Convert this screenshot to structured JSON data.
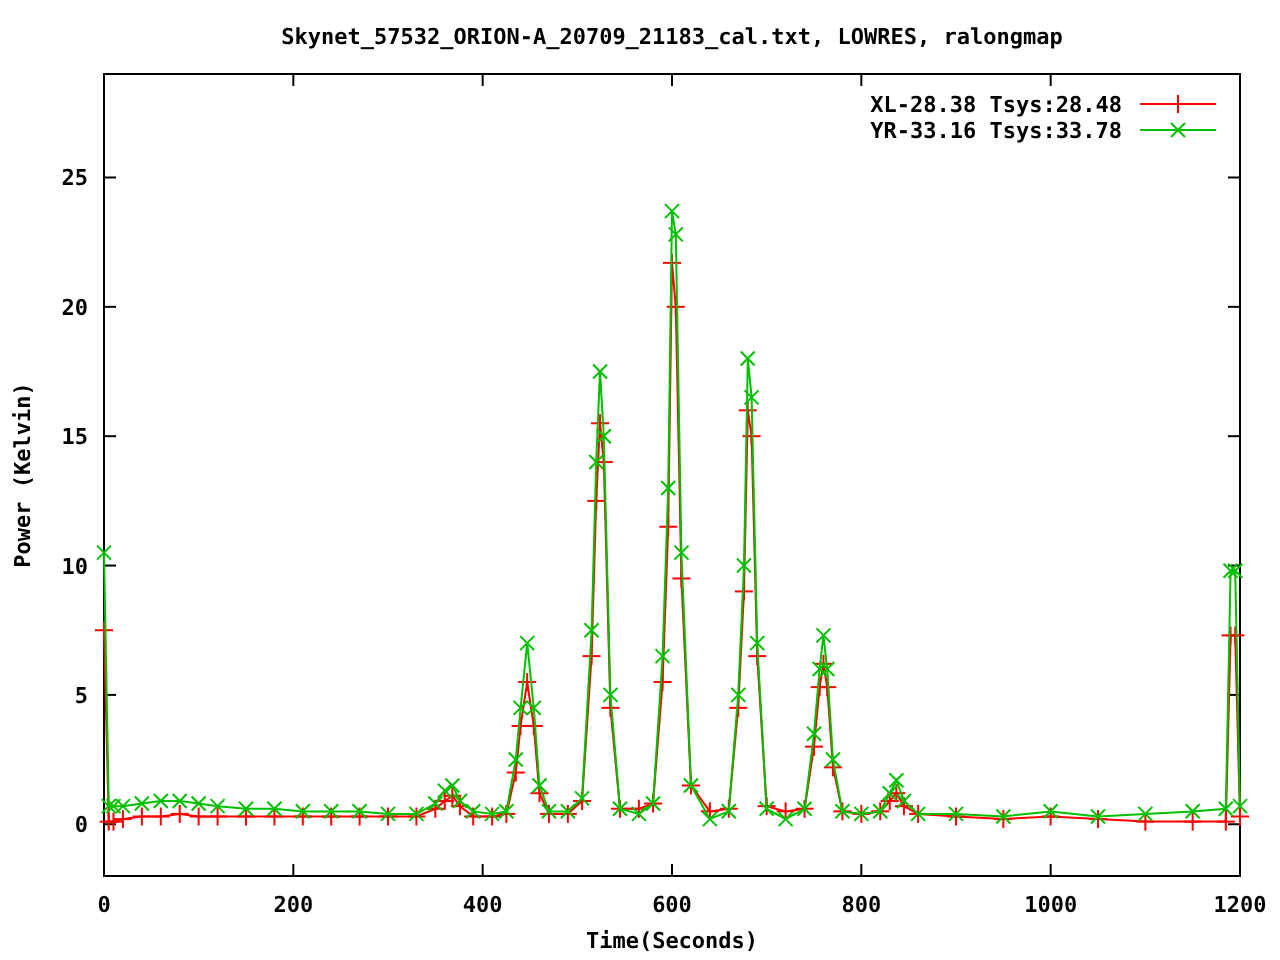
{
  "chart_data": {
    "type": "line",
    "title": "Skynet_57532_ORION-A_20709_21183_cal.txt, LOWRES, ralongmap",
    "xlabel": "Time(Seconds)",
    "ylabel": "Power (Kelvin)",
    "x": [
      0,
      5,
      10,
      20,
      40,
      60,
      80,
      100,
      120,
      150,
      180,
      210,
      240,
      270,
      300,
      330,
      350,
      360,
      368,
      376,
      390,
      410,
      425,
      435,
      440,
      447,
      454,
      460,
      470,
      490,
      505,
      515,
      520,
      524,
      528,
      535,
      545,
      565,
      580,
      590,
      596,
      600,
      604,
      610,
      620,
      640,
      660,
      670,
      676,
      680,
      684,
      690,
      700,
      720,
      740,
      750,
      756,
      760,
      764,
      770,
      780,
      800,
      820,
      830,
      837,
      845,
      860,
      900,
      950,
      1000,
      1050,
      1100,
      1150,
      1185,
      1190,
      1195,
      1200
    ],
    "series": [
      {
        "name": "XL-28.38 Tsys:28.48",
        "color": "#ff0000",
        "marker": "plus",
        "values": [
          7.5,
          0.1,
          0.1,
          0.2,
          0.3,
          0.3,
          0.4,
          0.3,
          0.3,
          0.3,
          0.3,
          0.3,
          0.3,
          0.3,
          0.3,
          0.3,
          0.6,
          0.9,
          1.1,
          0.7,
          0.3,
          0.3,
          0.4,
          2,
          3.8,
          5.5,
          3.8,
          1.2,
          0.4,
          0.4,
          0.9,
          6.5,
          12.5,
          15.5,
          14,
          4.5,
          0.6,
          0.6,
          0.8,
          5.5,
          11.5,
          21.7,
          20,
          9.5,
          1.5,
          0.5,
          0.6,
          4.5,
          9,
          16,
          15,
          6.5,
          0.7,
          0.5,
          0.6,
          3,
          5.3,
          6.2,
          5.3,
          2.2,
          0.5,
          0.4,
          0.5,
          0.9,
          1.2,
          0.7,
          0.4,
          0.3,
          0.2,
          0.3,
          0.2,
          0.1,
          0.1,
          0.1,
          7.3,
          7.3,
          0.3
        ]
      },
      {
        "name": "YR-33.16 Tsys:33.78",
        "color": "#00c000",
        "marker": "cross",
        "values": [
          10.5,
          0.7,
          0.7,
          0.7,
          0.8,
          0.9,
          0.9,
          0.8,
          0.7,
          0.6,
          0.6,
          0.5,
          0.5,
          0.5,
          0.4,
          0.4,
          0.8,
          1.3,
          1.5,
          0.9,
          0.5,
          0.4,
          0.5,
          2.5,
          4.5,
          7,
          4.5,
          1.5,
          0.5,
          0.5,
          1,
          7.5,
          14,
          17.5,
          15,
          5,
          0.6,
          0.4,
          0.8,
          6.5,
          13,
          23.7,
          22.8,
          10.5,
          1.5,
          0.2,
          0.5,
          5,
          10,
          18,
          16.5,
          7,
          0.6,
          0.2,
          0.6,
          3.5,
          6,
          7.3,
          6,
          2.5,
          0.5,
          0.4,
          0.5,
          1.2,
          1.7,
          0.9,
          0.4,
          0.4,
          0.3,
          0.5,
          0.3,
          0.4,
          0.5,
          0.6,
          9.8,
          9.8,
          0.7
        ]
      }
    ],
    "legend": true,
    "xlim": [
      0,
      1200
    ],
    "ylim": [
      -2,
      29
    ],
    "xticks": [
      0,
      200,
      400,
      600,
      800,
      1000,
      1200
    ],
    "yticks": [
      0,
      5,
      10,
      15,
      20,
      25
    ]
  }
}
